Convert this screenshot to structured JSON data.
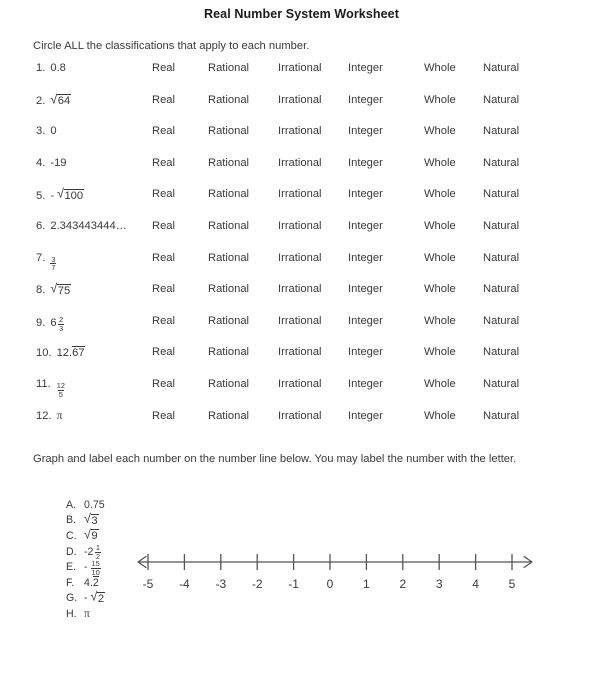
{
  "title": "Real Number System Worksheet",
  "instructions": {
    "classify": "Circle ALL the classifications that apply to each number.",
    "graph": "Graph and label each number on the number line below. You may label the number with the letter."
  },
  "classifications": [
    "Real",
    "Rational",
    "Irrational",
    "Integer",
    "Whole",
    "Natural"
  ],
  "items": [
    {
      "number": "1.",
      "value": "0.8",
      "type": "plain"
    },
    {
      "number": "2.",
      "value": "64",
      "type": "sqrt"
    },
    {
      "number": "3.",
      "value": "0",
      "type": "plain"
    },
    {
      "number": "4.",
      "value": "-19",
      "type": "plain"
    },
    {
      "number": "5.",
      "value": "100",
      "type": "neg-sqrt",
      "prefix": "-"
    },
    {
      "number": "6.",
      "value": "2.343443444…",
      "type": "plain"
    },
    {
      "number": "7.",
      "numerator": "3",
      "denominator": "7",
      "type": "fraction"
    },
    {
      "number": "8.",
      "value": "75",
      "type": "sqrt"
    },
    {
      "number": "9.",
      "whole": "6",
      "numerator": "2",
      "denominator": "3",
      "type": "mixed"
    },
    {
      "number": "10.",
      "value": "12.",
      "repeat": "67",
      "type": "repeating"
    },
    {
      "number": "11.",
      "numerator": "12",
      "denominator": "5",
      "type": "fraction"
    },
    {
      "number": "12.",
      "value": "π",
      "type": "pi"
    }
  ],
  "graph_items": [
    {
      "letter": "A.",
      "value": "0.75",
      "type": "plain"
    },
    {
      "letter": "B.",
      "value": "3",
      "type": "sqrt"
    },
    {
      "letter": "C.",
      "value": "9",
      "type": "sqrt"
    },
    {
      "letter": "D.",
      "whole": "-2",
      "numerator": "1",
      "denominator": "2",
      "type": "mixed"
    },
    {
      "letter": "E.",
      "prefix": "-",
      "numerator": "15",
      "denominator": "10",
      "type": "neg-fraction"
    },
    {
      "letter": "F.",
      "value": "4.",
      "repeat": "2",
      "type": "repeating"
    },
    {
      "letter": "G.",
      "prefix": "-",
      "value": "2",
      "type": "neg-sqrt"
    },
    {
      "letter": "H.",
      "value": "π",
      "type": "pi"
    }
  ],
  "number_line": {
    "ticks": [
      "-5",
      "-4",
      "-3",
      "-2",
      "-1",
      "0",
      "1",
      "2",
      "3",
      "4",
      "5"
    ],
    "min": -5,
    "max": 5,
    "left_arrow": true,
    "right_arrow": true,
    "line_color": "#555555"
  }
}
